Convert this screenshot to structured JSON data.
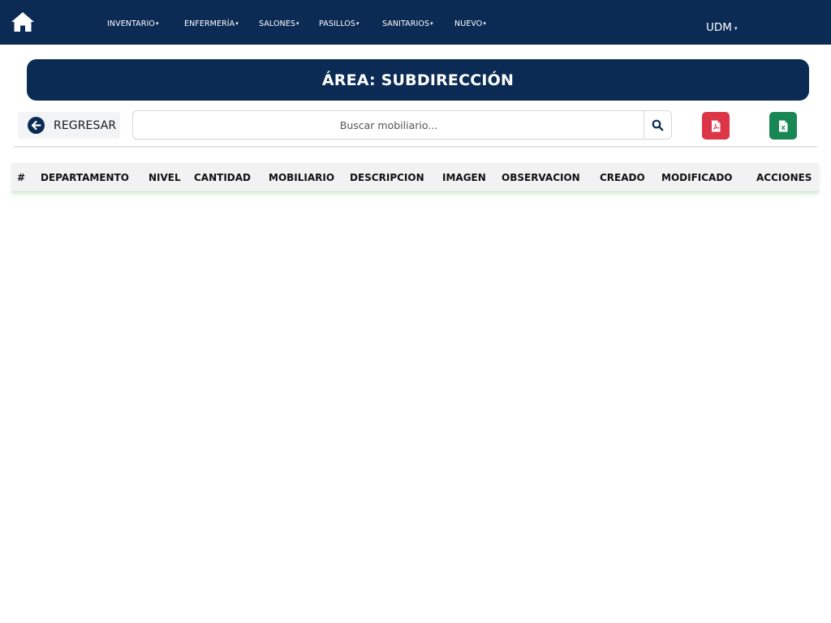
{
  "navbar": {
    "items": [
      {
        "label": "INVENTARIO",
        "caret": "▾"
      },
      {
        "label": "ENFERMERÍA",
        "caret": "▾"
      },
      {
        "label": "SALONES",
        "caret": "▾"
      },
      {
        "label": "PASILLOS",
        "caret": "▾"
      },
      {
        "label": "SANITARIOS",
        "caret": "▾"
      },
      {
        "label": "NUEVO",
        "caret": "▾"
      }
    ],
    "user": {
      "label": "UDM",
      "caret": "▾"
    }
  },
  "banner": {
    "title": "ÁREA: SUBDIRECCIÓN"
  },
  "toolbar": {
    "back_label": "REGRESAR",
    "search_placeholder": "Buscar mobiliario...",
    "pdf_icon_text": "PDF",
    "excel_icon_text": "X"
  },
  "table": {
    "columns": [
      "#",
      "DEPARTAMENTO",
      "NIVEL",
      "CANTIDAD",
      "MOBILIARIO",
      "DESCRIPCION",
      "IMAGEN",
      "OBSERVACION",
      "CREADO",
      "MODIFICADO",
      "ACCIONES"
    ],
    "rows": []
  },
  "colors": {
    "primary": "#0b2b55",
    "pdf": "#dc3545",
    "excel": "#198754",
    "search_icon": "#0b2b55"
  },
  "icons": {
    "home": "home-icon",
    "back": "arrow-left-circle-icon",
    "search": "search-icon",
    "pdf": "file-pdf-icon",
    "excel": "file-excel-icon"
  }
}
